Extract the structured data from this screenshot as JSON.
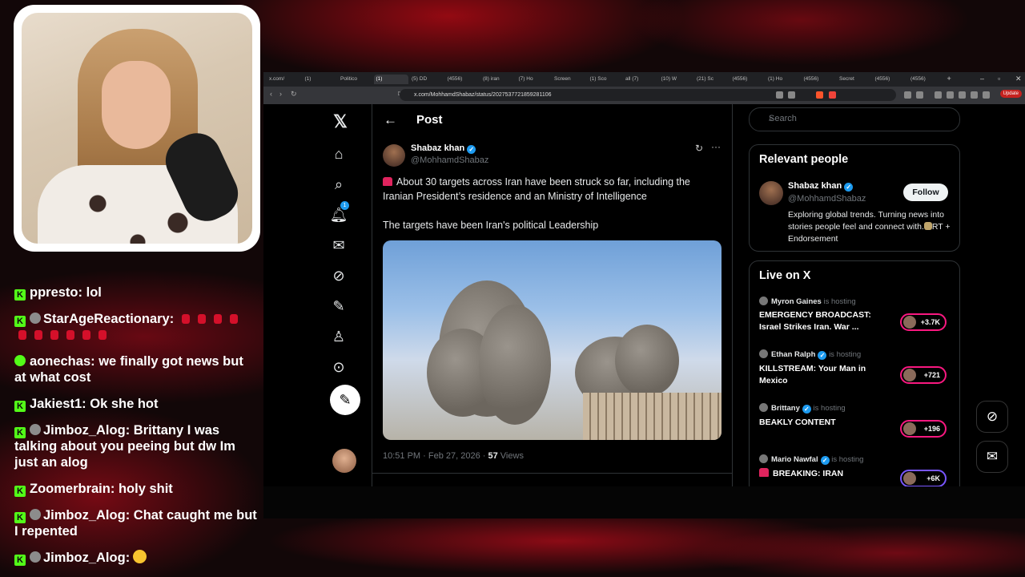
{
  "chat": {
    "messages": [
      {
        "user": "ppresto",
        "text": "lol",
        "badge": "kick"
      },
      {
        "user": "StarAgeReactionary",
        "text": "",
        "badge": "kick",
        "avatar": true,
        "emotes": 10
      },
      {
        "user": "aonechas",
        "text": "we finally got news but at what cost",
        "badge": "play"
      },
      {
        "user": "Jakiest1",
        "text": "Ok she hot",
        "badge": "kick"
      },
      {
        "user": "Jimboz_Alog",
        "text": "Brittany I was talking about you peeing but dw Im just an alog",
        "badge": "kick",
        "avatar": true
      },
      {
        "user": "Zoomerbrain",
        "text": "holy shit",
        "badge": "kick"
      },
      {
        "user": "Jimboz_Alog",
        "text": "Chat caught me but I repented",
        "badge": "kick",
        "avatar": true
      },
      {
        "user": "Jimboz_Alog",
        "text": "",
        "badge": "kick",
        "avatar": true,
        "smile": true
      }
    ]
  },
  "browser": {
    "tabs": [
      "x.com/",
      "(1)",
      "Politico",
      "(1)",
      "(5) DD",
      "(4556)",
      "(8) iran",
      "(7) Ho",
      "Screen",
      "(1) Sco",
      "all (7)",
      "(10) W",
      "(21) Sc",
      "(4556)",
      "(1) Ho",
      "(4556)",
      "Secret",
      "(4556)",
      "(4556)"
    ],
    "active_tab_index": 3,
    "url": "x.com/MohhamdShabaz/status/2027537721859281106",
    "update_label": "Update"
  },
  "x": {
    "header_title": "Post",
    "notification_count": "1",
    "post": {
      "author_name": "Shabaz khan",
      "author_handle": "@MohhamdShabaz",
      "text_line1": "About 30 targets across Iran have been struck so far, including the Iranian President’s residence and an Ministry of Intelligence",
      "text_line2": "The targets have been Iran's political Leadership",
      "time": "10:51 PM · Feb 27, 2026 ·",
      "views_count": "57",
      "views_label": "Views"
    },
    "search_placeholder": "Search",
    "relevant": {
      "title": "Relevant people",
      "name": "Shabaz khan",
      "handle": "@MohhamdShabaz",
      "follow_label": "Follow",
      "bio": "Exploring global trends. Turning news into stories people feel and connect with.",
      "bio_tail": "RT + Endorsement"
    },
    "live": {
      "title": "Live on X",
      "hosting_label": "is hosting",
      "items": [
        {
          "host": "Myron Gaines",
          "verified": false,
          "title": "EMERGENCY BROADCAST: Israel Strikes Iran. War ...",
          "count": "+3.7K"
        },
        {
          "host": "Ethan Ralph",
          "verified": true,
          "title": "KILLSTREAM: Your Man in Mexico",
          "count": "+721"
        },
        {
          "host": "Brittany",
          "verified": true,
          "title": "BEAKLY CONTENT",
          "count": "+196"
        },
        {
          "host": "Mario Nawfal",
          "verified": true,
          "title": "BREAKING: IRAN",
          "count": "+6K"
        }
      ]
    }
  },
  "colors": {
    "accent": "#1d9bf0",
    "kick": "#53fc18",
    "live_pill": "#f91880"
  }
}
